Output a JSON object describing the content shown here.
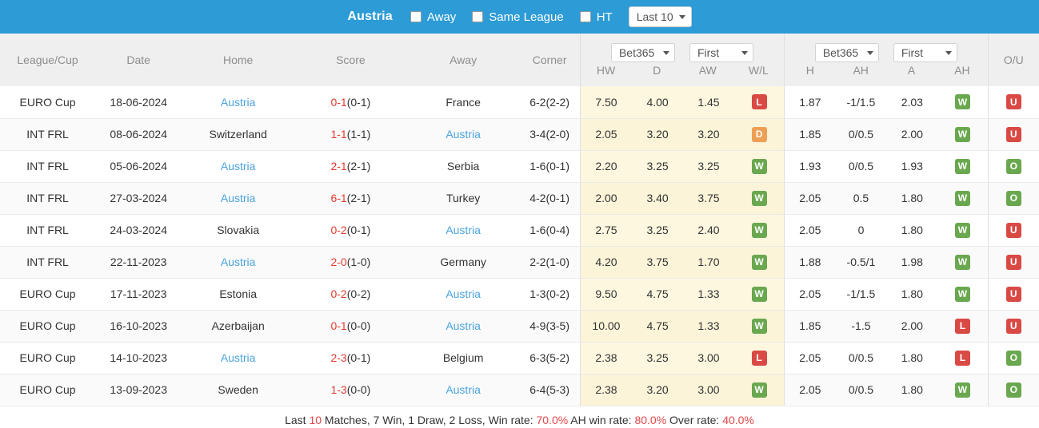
{
  "topbar": {
    "team": "Austria",
    "checkboxes": [
      {
        "label": "Away",
        "checked": false
      },
      {
        "label": "Same League",
        "checked": false
      },
      {
        "label": "HT",
        "checked": false
      }
    ],
    "range_select": {
      "value": "Last 10",
      "icon": "chevron-down-icon"
    }
  },
  "header": {
    "league": "League/Cup",
    "date": "Date",
    "home": "Home",
    "score": "Score",
    "away": "Away",
    "corner": "Corner",
    "ou": "O/U",
    "group1": {
      "bookmaker": "Bet365",
      "period": "First",
      "cols": [
        "HW",
        "D",
        "AW",
        "W/L"
      ]
    },
    "group2": {
      "bookmaker": "Bet365",
      "period": "First",
      "cols": [
        "H",
        "AH",
        "A",
        "AH"
      ]
    }
  },
  "rows": [
    {
      "league": "EURO Cup",
      "date": "18-06-2024",
      "home": "Austria",
      "home_link": true,
      "score_main": "0-1",
      "score_sub": "(0-1)",
      "away": "France",
      "away_link": false,
      "corner": "6-2(2-2)",
      "hw": "7.50",
      "d": "4.00",
      "aw": "1.45",
      "wl": "L",
      "wl_type": "l",
      "h": "1.87",
      "ah1": "-1/1.5",
      "a": "2.03",
      "ah2": "W",
      "ah2_type": "w",
      "ou": "U",
      "ou_type": "u"
    },
    {
      "league": "INT FRL",
      "date": "08-06-2024",
      "home": "Switzerland",
      "home_link": false,
      "score_main": "1-1",
      "score_sub": "(1-1)",
      "away": "Austria",
      "away_link": true,
      "corner": "3-4(2-0)",
      "hw": "2.05",
      "d": "3.20",
      "aw": "3.20",
      "wl": "D",
      "wl_type": "d",
      "h": "1.85",
      "ah1": "0/0.5",
      "a": "2.00",
      "ah2": "W",
      "ah2_type": "w",
      "ou": "U",
      "ou_type": "u"
    },
    {
      "league": "INT FRL",
      "date": "05-06-2024",
      "home": "Austria",
      "home_link": true,
      "score_main": "2-1",
      "score_sub": "(2-1)",
      "away": "Serbia",
      "away_link": false,
      "corner": "1-6(0-1)",
      "hw": "2.20",
      "d": "3.25",
      "aw": "3.25",
      "wl": "W",
      "wl_type": "w",
      "h": "1.93",
      "ah1": "0/0.5",
      "a": "1.93",
      "ah2": "W",
      "ah2_type": "w",
      "ou": "O",
      "ou_type": "o"
    },
    {
      "league": "INT FRL",
      "date": "27-03-2024",
      "home": "Austria",
      "home_link": true,
      "score_main": "6-1",
      "score_sub": "(2-1)",
      "away": "Turkey",
      "away_link": false,
      "corner": "4-2(0-1)",
      "hw": "2.00",
      "d": "3.40",
      "aw": "3.75",
      "wl": "W",
      "wl_type": "w",
      "h": "2.05",
      "ah1": "0.5",
      "a": "1.80",
      "ah2": "W",
      "ah2_type": "w",
      "ou": "O",
      "ou_type": "o"
    },
    {
      "league": "INT FRL",
      "date": "24-03-2024",
      "home": "Slovakia",
      "home_link": false,
      "score_main": "0-2",
      "score_sub": "(0-1)",
      "away": "Austria",
      "away_link": true,
      "corner": "1-6(0-4)",
      "hw": "2.75",
      "d": "3.25",
      "aw": "2.40",
      "wl": "W",
      "wl_type": "w",
      "h": "2.05",
      "ah1": "0",
      "a": "1.80",
      "ah2": "W",
      "ah2_type": "w",
      "ou": "U",
      "ou_type": "u"
    },
    {
      "league": "INT FRL",
      "date": "22-11-2023",
      "home": "Austria",
      "home_link": true,
      "score_main": "2-0",
      "score_sub": "(1-0)",
      "away": "Germany",
      "away_link": false,
      "corner": "2-2(1-0)",
      "hw": "4.20",
      "d": "3.75",
      "aw": "1.70",
      "wl": "W",
      "wl_type": "w",
      "h": "1.88",
      "ah1": "-0.5/1",
      "a": "1.98",
      "ah2": "W",
      "ah2_type": "w",
      "ou": "U",
      "ou_type": "u"
    },
    {
      "league": "EURO Cup",
      "date": "17-11-2023",
      "home": "Estonia",
      "home_link": false,
      "score_main": "0-2",
      "score_sub": "(0-2)",
      "away": "Austria",
      "away_link": true,
      "corner": "1-3(0-2)",
      "hw": "9.50",
      "d": "4.75",
      "aw": "1.33",
      "wl": "W",
      "wl_type": "w",
      "h": "2.05",
      "ah1": "-1/1.5",
      "a": "1.80",
      "ah2": "W",
      "ah2_type": "w",
      "ou": "U",
      "ou_type": "u"
    },
    {
      "league": "EURO Cup",
      "date": "16-10-2023",
      "home": "Azerbaijan",
      "home_link": false,
      "score_main": "0-1",
      "score_sub": "(0-0)",
      "away": "Austria",
      "away_link": true,
      "corner": "4-9(3-5)",
      "hw": "10.00",
      "d": "4.75",
      "aw": "1.33",
      "wl": "W",
      "wl_type": "w",
      "h": "1.85",
      "ah1": "-1.5",
      "a": "2.00",
      "ah2": "L",
      "ah2_type": "l",
      "ou": "U",
      "ou_type": "u"
    },
    {
      "league": "EURO Cup",
      "date": "14-10-2023",
      "home": "Austria",
      "home_link": true,
      "score_main": "2-3",
      "score_sub": "(0-1)",
      "away": "Belgium",
      "away_link": false,
      "corner": "6-3(5-2)",
      "hw": "2.38",
      "d": "3.25",
      "aw": "3.00",
      "wl": "L",
      "wl_type": "l",
      "h": "2.05",
      "ah1": "0/0.5",
      "a": "1.80",
      "ah2": "L",
      "ah2_type": "l",
      "ou": "O",
      "ou_type": "o"
    },
    {
      "league": "EURO Cup",
      "date": "13-09-2023",
      "home": "Sweden",
      "home_link": false,
      "score_main": "1-3",
      "score_sub": "(0-0)",
      "away": "Austria",
      "away_link": true,
      "corner": "6-4(5-3)",
      "hw": "2.38",
      "d": "3.20",
      "aw": "3.00",
      "wl": "W",
      "wl_type": "w",
      "h": "2.05",
      "ah1": "0/0.5",
      "a": "1.80",
      "ah2": "W",
      "ah2_type": "w",
      "ou": "O",
      "ou_type": "o"
    }
  ],
  "footer": {
    "t1": "Last ",
    "count": "10",
    "t2": " Matches, 7 Win, 1 Draw, 2 Loss, Win rate: ",
    "win_rate": "70.0%",
    "t3": " AH win rate: ",
    "ah_win_rate": "80.0%",
    "t4": " Over rate: ",
    "over_rate": "40.0%"
  },
  "colors": {
    "accent": "#2c9bd6",
    "link": "#4aa3df",
    "score": "#e23b2e",
    "win": "#6aa84f",
    "loss": "#d94a45",
    "draw": "#eda054",
    "highlight": "#fdf7df"
  }
}
